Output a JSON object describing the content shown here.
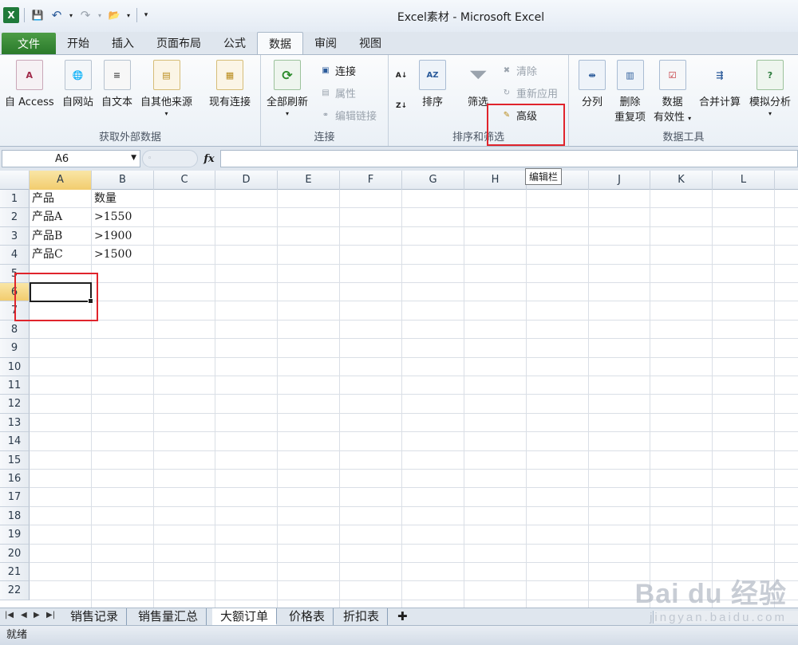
{
  "window": {
    "title": "Excel素材 - Microsoft Excel"
  },
  "tabs": [
    {
      "label": "文件"
    },
    {
      "label": "开始"
    },
    {
      "label": "插入"
    },
    {
      "label": "页面布局"
    },
    {
      "label": "公式"
    },
    {
      "label": "数据"
    },
    {
      "label": "审阅"
    },
    {
      "label": "视图"
    }
  ],
  "ribbon": {
    "external": {
      "label": "获取外部数据",
      "access": "自 Access",
      "web": "自网站",
      "text": "自文本",
      "other": "自其他来源",
      "existing": "现有连接"
    },
    "connections": {
      "label": "连接",
      "refresh_all": "全部刷新",
      "connections": "连接",
      "properties": "属性",
      "edit_links": "编辑链接"
    },
    "sort_filter": {
      "label": "排序和筛选",
      "sort": "排序",
      "filter": "筛选",
      "clear": "清除",
      "reapply": "重新应用",
      "advanced": "高级"
    },
    "tools": {
      "label": "数据工具",
      "split": "分列",
      "remove_dup_1": "删除",
      "remove_dup_2": "重复项",
      "validation_1": "数据",
      "validation_2": "有效性",
      "consolidate": "合并计算",
      "what_if": "模拟分析"
    }
  },
  "formula_bar": {
    "name_box": "A6",
    "fx": "fx",
    "formula": ""
  },
  "tooltip": "编辑栏",
  "columns": [
    "A",
    "B",
    "C",
    "D",
    "E",
    "F",
    "G",
    "H",
    "I",
    "J",
    "K",
    "L"
  ],
  "rows": [
    "1",
    "2",
    "3",
    "4",
    "5",
    "6",
    "7",
    "8",
    "9",
    "10",
    "11",
    "12",
    "13",
    "14",
    "15",
    "16",
    "17",
    "18",
    "19",
    "20",
    "21",
    "22"
  ],
  "cells": {
    "A1": "产品",
    "B1": "数量",
    "A2": "产品A",
    "B2": ">1550",
    "A3": "产品B",
    "B3": ">1900",
    "A4": "产品C",
    "B4": ">1500"
  },
  "sheets": [
    "销售记录",
    "销售量汇总",
    "大额订单",
    "价格表",
    "折扣表"
  ],
  "active_sheet": "大额订单",
  "status": "就绪",
  "watermark": {
    "brand": "Bai du 经验",
    "url": "jingyan.baidu.com"
  }
}
